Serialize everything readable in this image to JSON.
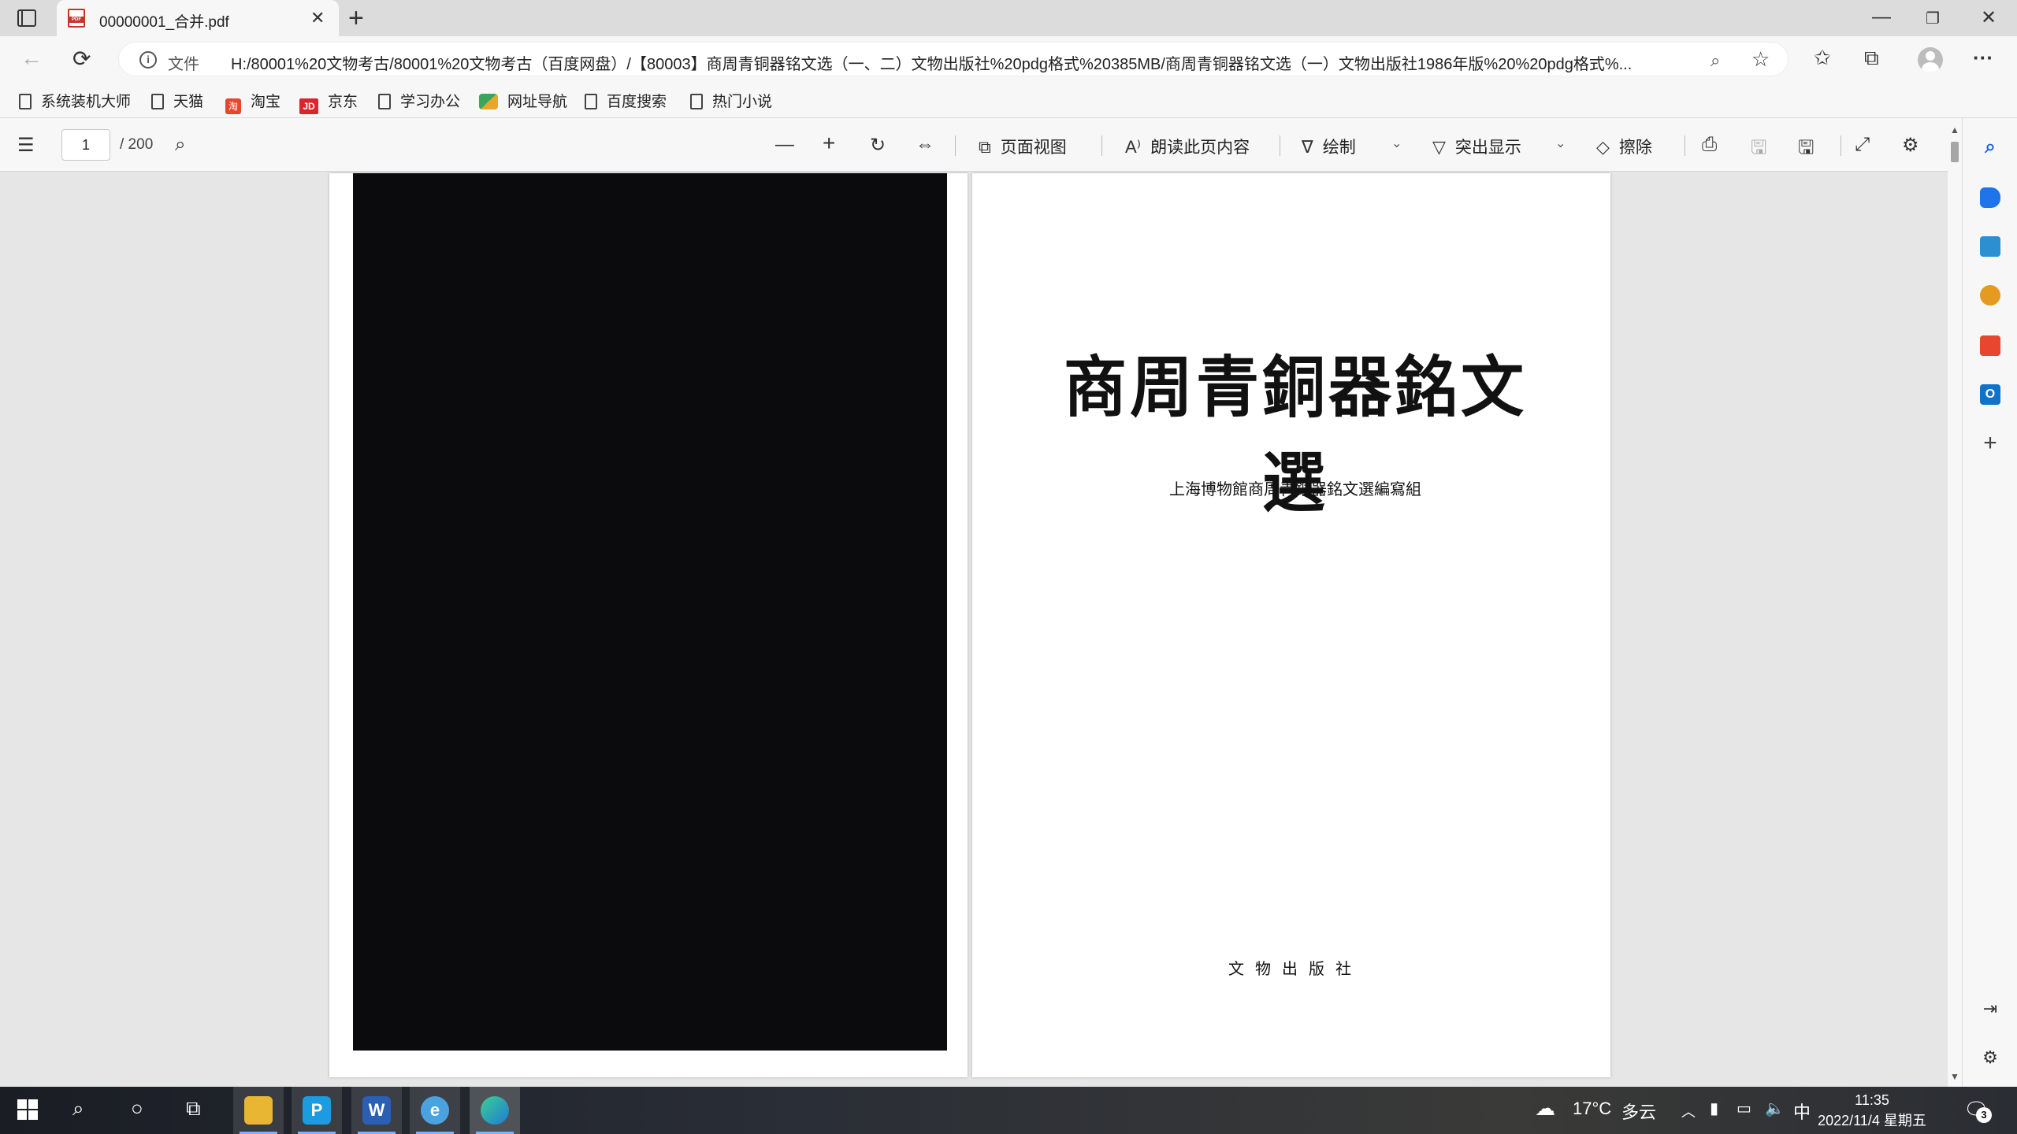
{
  "browser": {
    "tab": {
      "title": "00000001_合并.pdf",
      "icon": "pdf-icon"
    },
    "new_tab_label": "+",
    "window_controls": {
      "minimize": "—",
      "restore": "❐",
      "close": "✕"
    }
  },
  "address_bar": {
    "back_icon": "←",
    "refresh_icon": "⟳",
    "file_label": "文件",
    "url": "H:/80001%20文物考古/80001%20文物考古（百度网盘）/【80003】商周青铜器铭文选（一、二）文物出版社%20pdg格式%20385MB/商周青铜器铭文选（一）文物出版社1986年版%20%20pdg格式%...",
    "zoom_icon": "⌕",
    "favorite_icon": "☆"
  },
  "toolbar_icons": {
    "favorites": "✩",
    "collections": "⧉",
    "more": "···"
  },
  "bookmarks": [
    {
      "label": "系统装机大师",
      "icon": "page"
    },
    {
      "label": "天猫",
      "icon": "page"
    },
    {
      "label": "淘宝",
      "icon": "tmall"
    },
    {
      "label": "京东",
      "icon": "jd"
    },
    {
      "label": "学习办公",
      "icon": "page"
    },
    {
      "label": "网址导航",
      "icon": "nav"
    },
    {
      "label": "百度搜索",
      "icon": "page"
    },
    {
      "label": "热门小说",
      "icon": "page"
    }
  ],
  "pdf_toolbar": {
    "current_page": "1",
    "total_pages": "/ 200",
    "zoom_out": "—",
    "zoom_in": "+",
    "rotate": "↻",
    "fit": "⇔",
    "page_view": "页面视图",
    "read_aloud": "朗读此页内容",
    "draw": "绘制",
    "highlight": "突出显示",
    "erase": "擦除",
    "print": "⎙",
    "save": "🖫",
    "save_as": "🖫",
    "fullscreen": "⤢",
    "settings": "⚙"
  },
  "document": {
    "right_page": {
      "title": "商周青銅器銘文選",
      "editor": "上海博物館商周青銅器銘文選編寫組",
      "publisher": "文物出版社"
    }
  },
  "taskbar": {
    "weather_temp": "17°C",
    "weather_desc": "多云",
    "ime": "中",
    "time": "11:35",
    "date": "2022/11/4 星期五",
    "notifications": "3"
  }
}
